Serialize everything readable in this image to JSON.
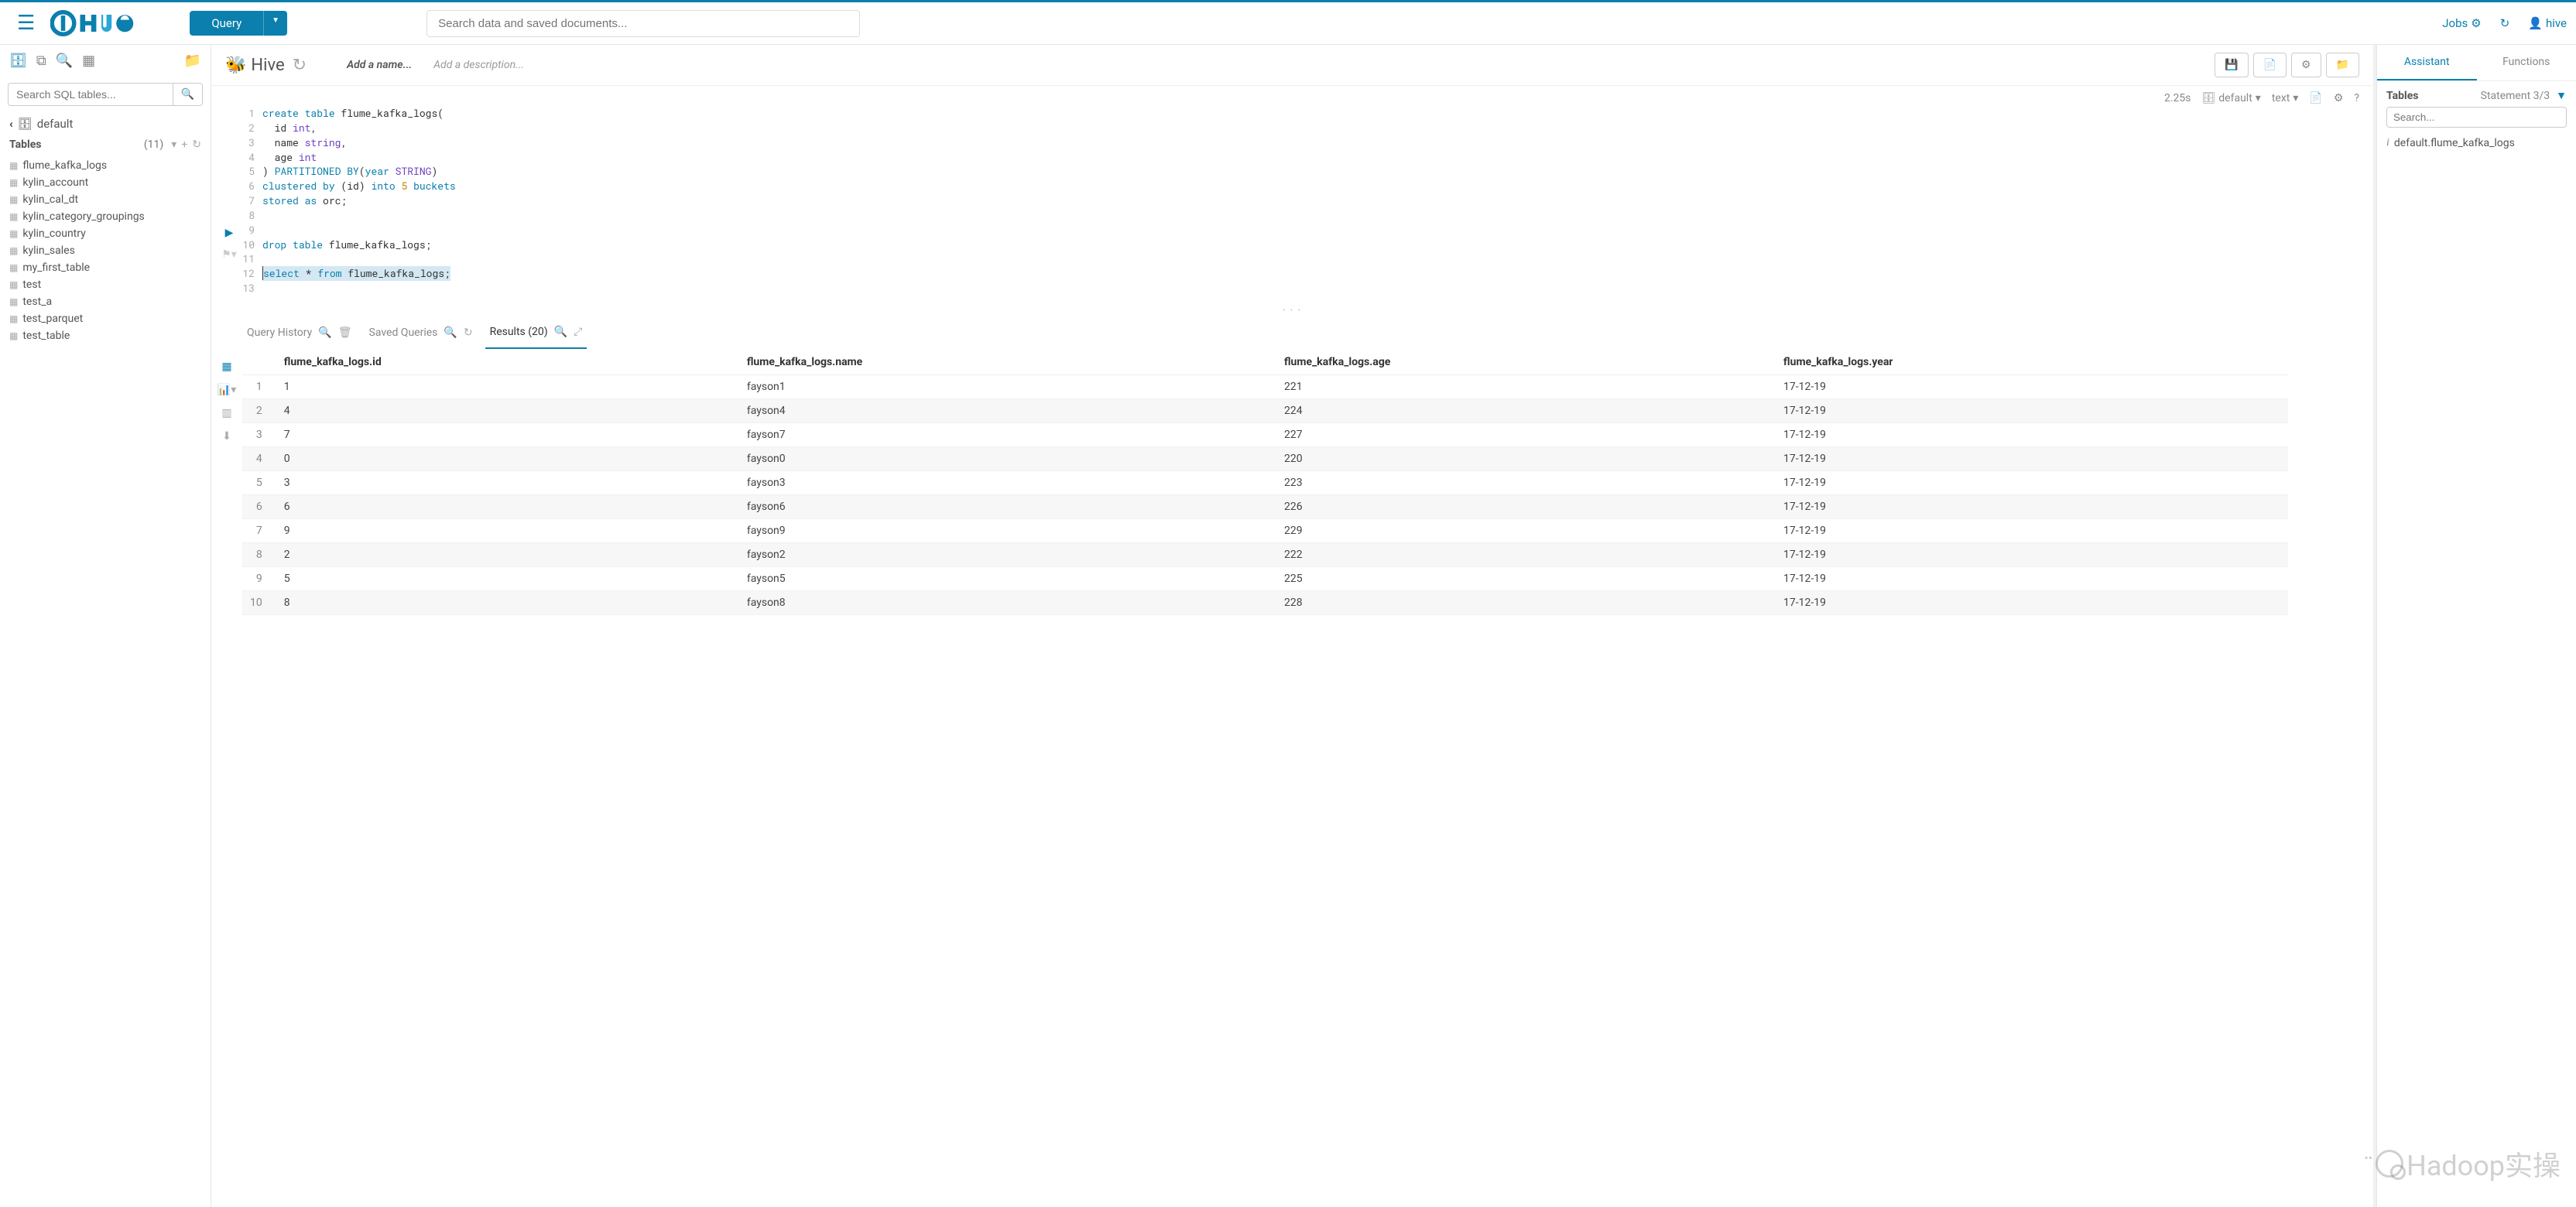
{
  "top": {
    "query_label": "Query",
    "search_placeholder": "Search data and saved documents...",
    "jobs": "Jobs",
    "user": "hive"
  },
  "left": {
    "search_placeholder": "Search SQL tables...",
    "database": "default",
    "tables_label": "Tables",
    "table_count": "(11)",
    "tables": [
      "flume_kafka_logs",
      "kylin_account",
      "kylin_cal_dt",
      "kylin_category_groupings",
      "kylin_country",
      "kylin_sales",
      "my_first_table",
      "test",
      "test_a",
      "test_parquet",
      "test_table"
    ]
  },
  "editor": {
    "engine": "Hive",
    "name_placeholder": "Add a name...",
    "desc_placeholder": "Add a description...",
    "exec_time": "2.25s",
    "db": "default",
    "type": "text",
    "code_lines": [
      {
        "n": 1,
        "tokens": [
          [
            "kw",
            "create "
          ],
          [
            "kw",
            "table "
          ],
          [
            "",
            "flume_kafka_logs("
          ]
        ]
      },
      {
        "n": 2,
        "tokens": [
          [
            "",
            "  id "
          ],
          [
            "ty",
            "int"
          ],
          [
            "",
            ","
          ]
        ]
      },
      {
        "n": 3,
        "tokens": [
          [
            "",
            "  name "
          ],
          [
            "ty",
            "string"
          ],
          [
            "",
            ","
          ]
        ]
      },
      {
        "n": 4,
        "tokens": [
          [
            "",
            "  age "
          ],
          [
            "ty",
            "int"
          ]
        ]
      },
      {
        "n": 5,
        "tokens": [
          [
            "",
            ") "
          ],
          [
            "kw",
            "PARTITIONED BY"
          ],
          [
            "",
            "("
          ],
          [
            "kw",
            "year "
          ],
          [
            "ty",
            "STRING"
          ],
          [
            "",
            ")"
          ]
        ]
      },
      {
        "n": 6,
        "tokens": [
          [
            "kw",
            "clustered by "
          ],
          [
            "",
            "(id) "
          ],
          [
            "kw",
            "into "
          ],
          [
            "num",
            "5 "
          ],
          [
            "kw",
            "buckets"
          ]
        ]
      },
      {
        "n": 7,
        "tokens": [
          [
            "kw",
            "stored "
          ],
          [
            "kw",
            "as "
          ],
          [
            "",
            "orc;"
          ]
        ]
      },
      {
        "n": 8,
        "tokens": [
          [
            "",
            ""
          ]
        ]
      },
      {
        "n": 9,
        "tokens": [
          [
            "",
            ""
          ]
        ]
      },
      {
        "n": 10,
        "tokens": [
          [
            "kw",
            "drop "
          ],
          [
            "kw",
            "table "
          ],
          [
            "",
            "flume_kafka_logs;"
          ]
        ]
      },
      {
        "n": 11,
        "tokens": [
          [
            "",
            ""
          ]
        ]
      },
      {
        "n": 12,
        "hl": true,
        "tokens": [
          [
            "kw",
            "select "
          ],
          [
            "",
            "* "
          ],
          [
            "kw",
            "from "
          ],
          [
            "",
            "flume_kafka_logs;"
          ]
        ]
      },
      {
        "n": 13,
        "tokens": [
          [
            "",
            ""
          ]
        ]
      }
    ]
  },
  "tabs": {
    "history": "Query History",
    "saved": "Saved Queries",
    "results": "Results (20)"
  },
  "results": {
    "columns": [
      "",
      "flume_kafka_logs.id",
      "flume_kafka_logs.name",
      "flume_kafka_logs.age",
      "flume_kafka_logs.year"
    ],
    "rows": [
      [
        1,
        "1",
        "fayson1",
        "221",
        "17-12-19"
      ],
      [
        2,
        "4",
        "fayson4",
        "224",
        "17-12-19"
      ],
      [
        3,
        "7",
        "fayson7",
        "227",
        "17-12-19"
      ],
      [
        4,
        "0",
        "fayson0",
        "220",
        "17-12-19"
      ],
      [
        5,
        "3",
        "fayson3",
        "223",
        "17-12-19"
      ],
      [
        6,
        "6",
        "fayson6",
        "226",
        "17-12-19"
      ],
      [
        7,
        "9",
        "fayson9",
        "229",
        "17-12-19"
      ],
      [
        8,
        "2",
        "fayson2",
        "222",
        "17-12-19"
      ],
      [
        9,
        "5",
        "fayson5",
        "225",
        "17-12-19"
      ],
      [
        10,
        "8",
        "fayson8",
        "228",
        "17-12-19"
      ]
    ]
  },
  "right": {
    "tab_assistant": "Assistant",
    "tab_functions": "Functions",
    "tables_label": "Tables",
    "statement": "Statement 3/3",
    "search_placeholder": "Search...",
    "item": "default.flume_kafka_logs"
  },
  "watermark": "Hadoop实操"
}
